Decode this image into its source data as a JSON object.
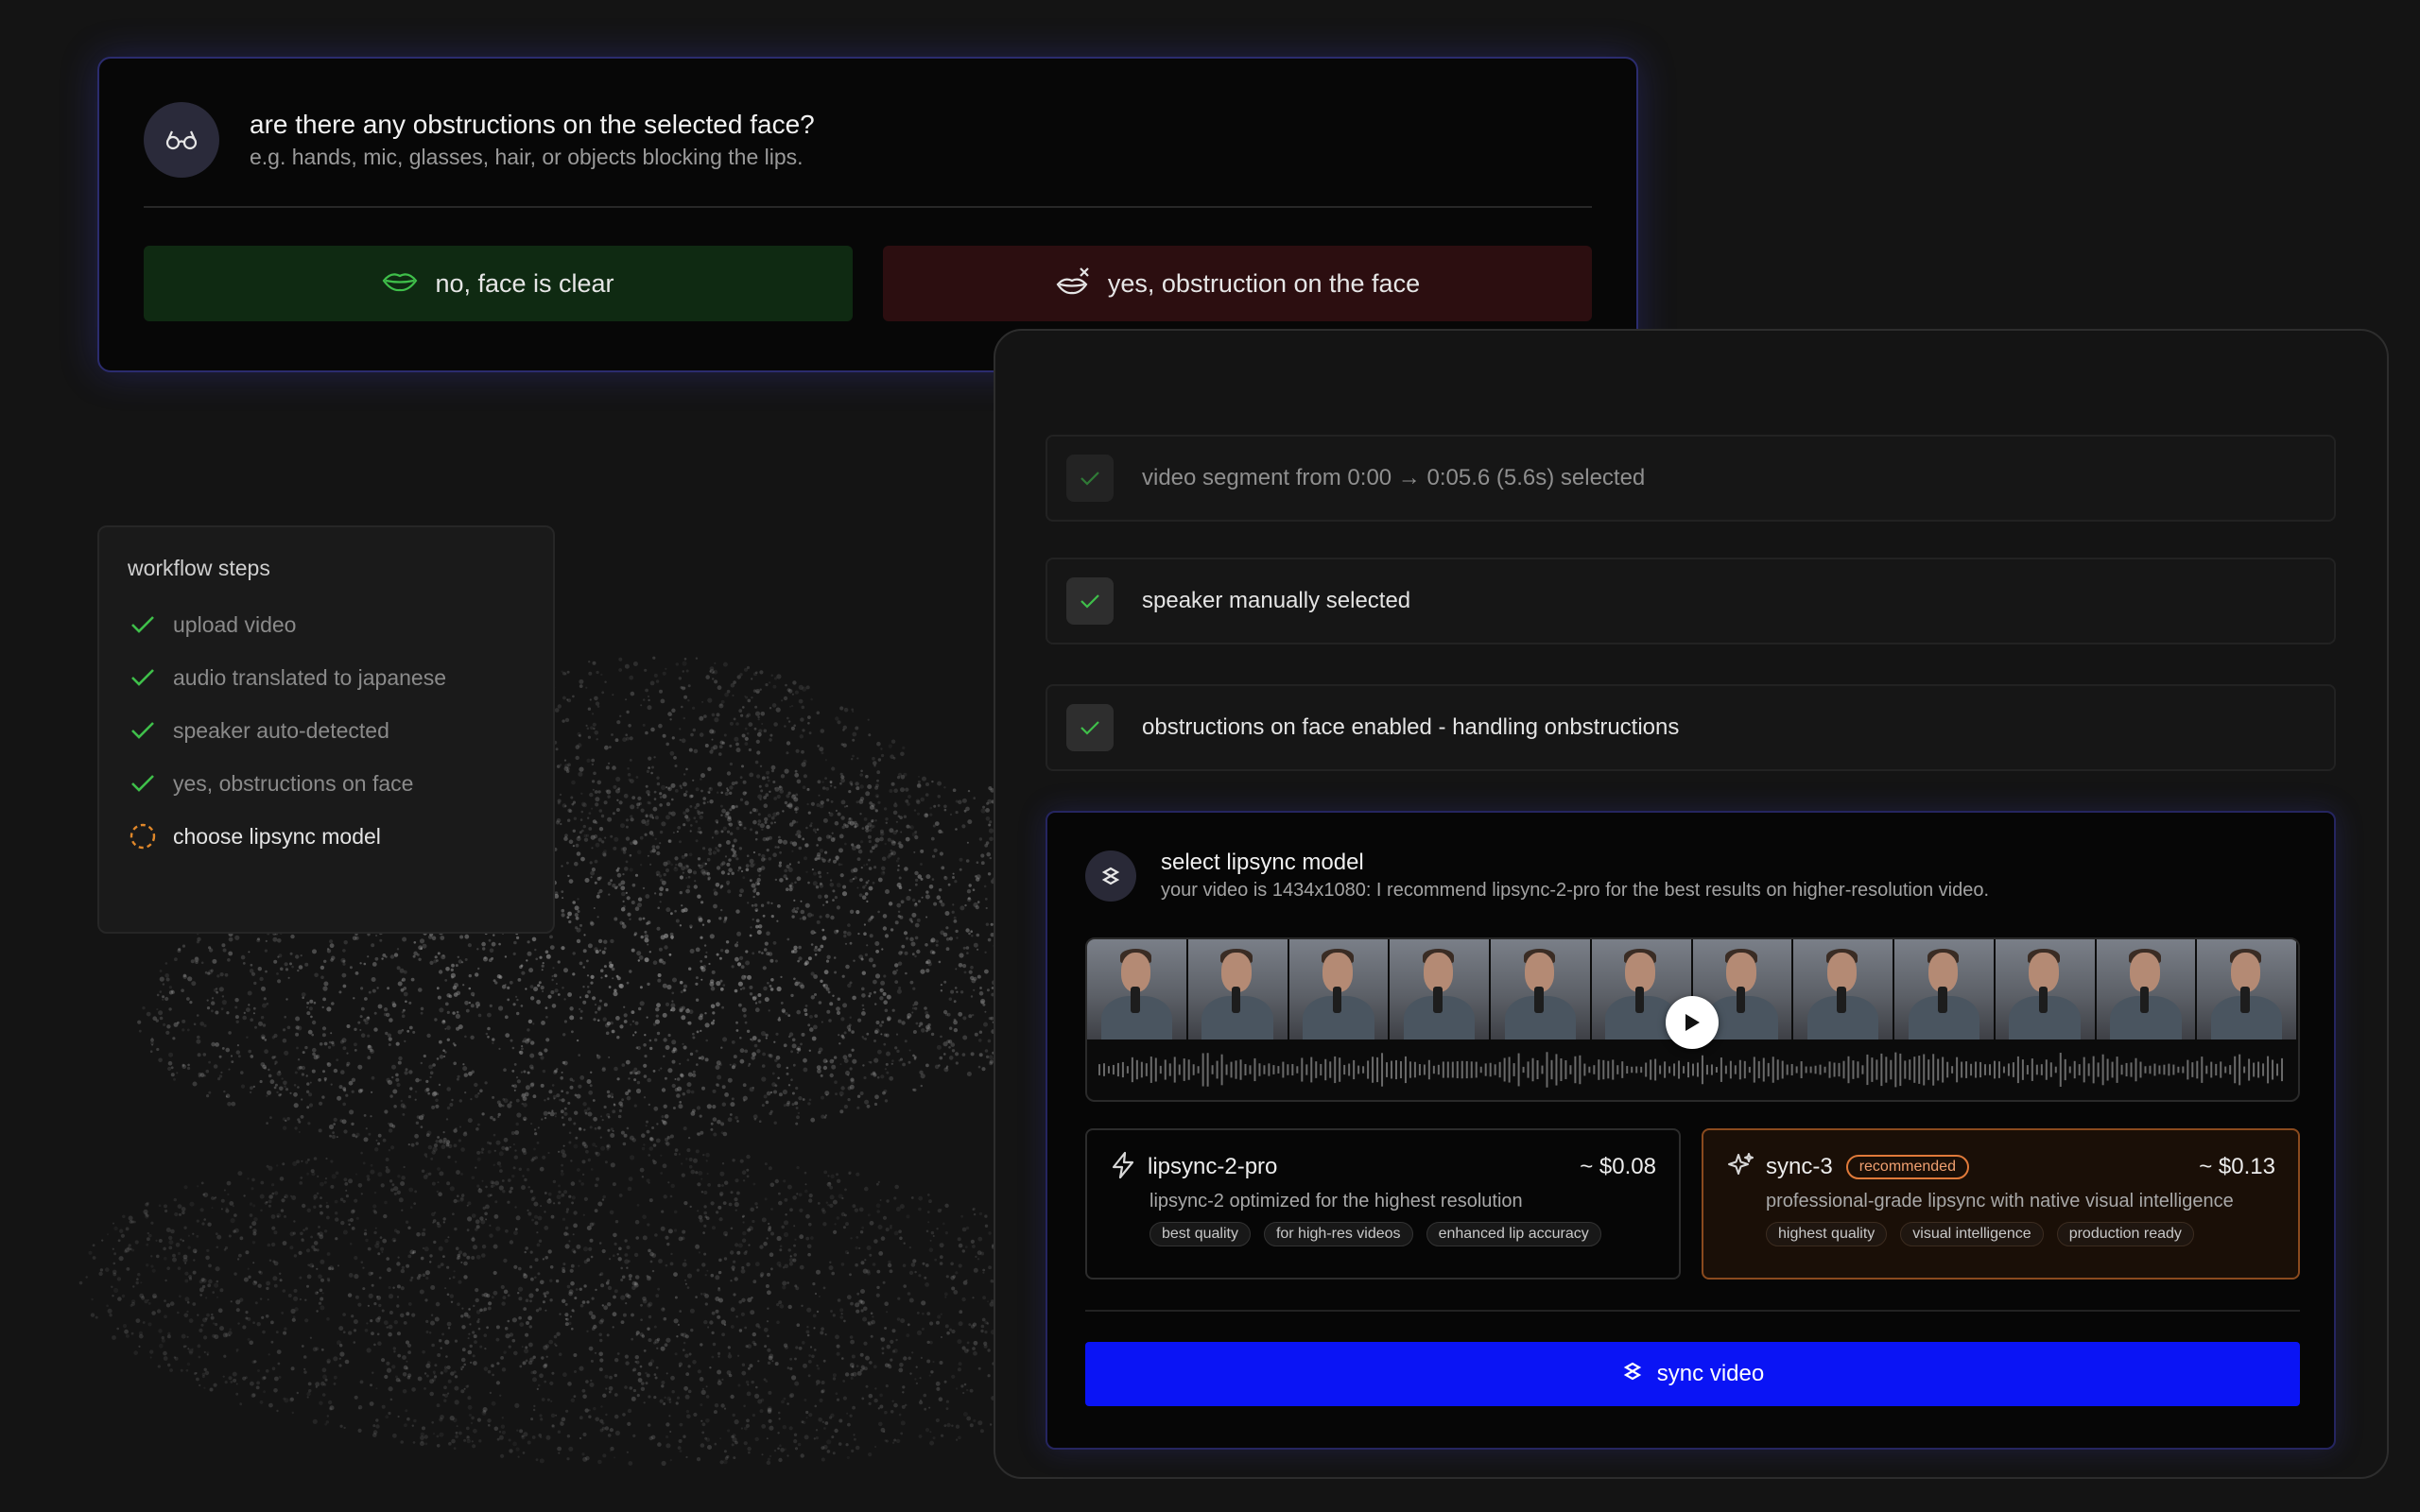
{
  "obstruction_prompt": {
    "title": "are there any obstructions on the selected face?",
    "subtitle": "e.g. hands, mic, glasses, hair, or objects blocking the lips.",
    "icon": "glasses-icon",
    "clear_button": {
      "label": "no, face is clear",
      "icon": "lips-icon",
      "color": "#0f2a12",
      "icon_color": "#3fbf4a"
    },
    "obstruction_button": {
      "label": "yes, obstruction on the face",
      "icon": "lips-obstructed-icon",
      "color": "#2c0e10"
    }
  },
  "workflow": {
    "title": "workflow steps",
    "steps": [
      {
        "label": "upload video",
        "status": "done"
      },
      {
        "label": "audio translated to japanese",
        "status": "done"
      },
      {
        "label": "speaker auto-detected",
        "status": "done"
      },
      {
        "label": "yes, obstructions on face",
        "status": "done"
      },
      {
        "label": "choose lipsync model",
        "status": "in-progress"
      }
    ],
    "done_color": "#3fbf4a",
    "pending_color": "#e0882a"
  },
  "status_items": [
    {
      "label": "video segment from 0:00 → 0:05.6 (5.6s) selected"
    },
    {
      "label": "speaker manually selected"
    },
    {
      "label": "obstructions on face enabled - handling onbstructions"
    }
  ],
  "model_select": {
    "title": "select lipsync model",
    "subtitle": "your video is 1434x1080: I recommend lipsync-2-pro for the best results on higher-resolution video.",
    "frame_count": 12,
    "options": [
      {
        "name": "lipsync-2-pro",
        "icon": "lightning-icon",
        "price": "~ $0.08",
        "description": "lipsync-2 optimized for the highest resolution",
        "tags": [
          "best quality",
          "for high-res videos",
          "enhanced lip accuracy"
        ]
      },
      {
        "name": "sync-3",
        "icon": "sparkle-icon",
        "badge": "recommended",
        "price": "~ $0.13",
        "description": "professional-grade lipsync with native visual intelligence",
        "tags": [
          "highest quality",
          "visual intelligence",
          "production ready"
        ]
      }
    ],
    "sync_button": {
      "label": "sync video",
      "color": "#0a14f5"
    }
  }
}
